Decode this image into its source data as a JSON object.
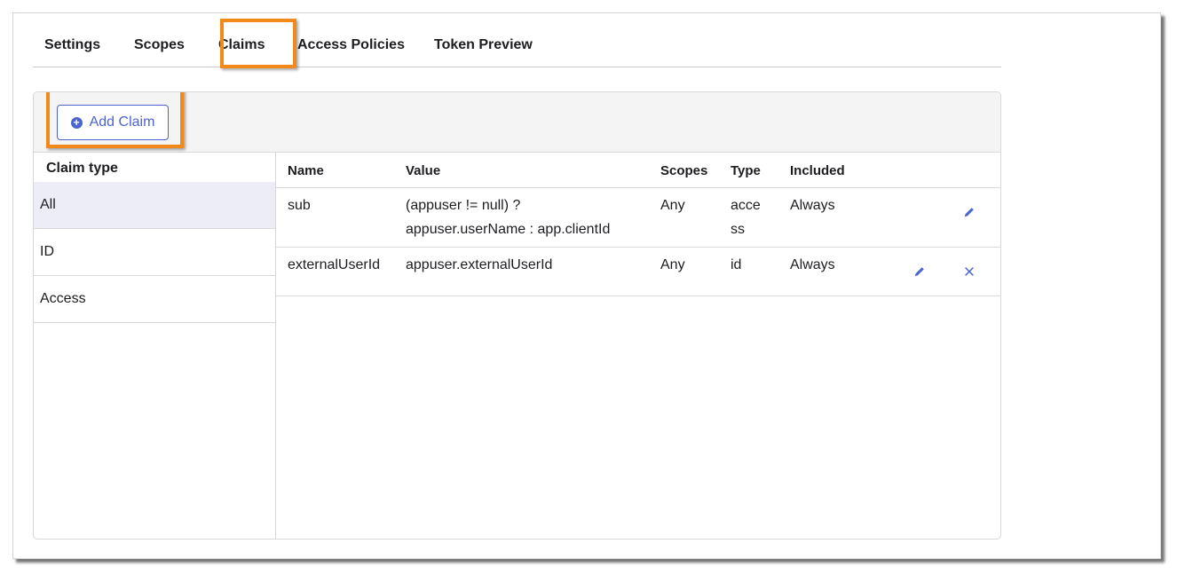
{
  "tabs": [
    {
      "label": "Settings"
    },
    {
      "label": "Scopes"
    },
    {
      "label": "Claims"
    },
    {
      "label": "Access Policies"
    },
    {
      "label": "Token Preview"
    }
  ],
  "active_tab": "Claims",
  "toolbar": {
    "add_claim_label": "Add Claim"
  },
  "sidebar": {
    "title": "Claim type",
    "items": [
      {
        "label": "All"
      },
      {
        "label": "ID"
      },
      {
        "label": "Access"
      }
    ],
    "active_item": "All"
  },
  "table": {
    "headers": {
      "name": "Name",
      "value": "Value",
      "scopes": "Scopes",
      "type": "Type",
      "included": "Included"
    },
    "rows": [
      {
        "name": "sub",
        "value_line1": "(appuser != null) ?",
        "value_line2": "appuser.userName : app.clientId",
        "scopes": "Any",
        "type_line1": "acce",
        "type_line2": "ss",
        "included": "Always"
      },
      {
        "name": "externalUserId",
        "value_line1": "appuser.externalUserId",
        "scopes": "Any",
        "type_line1": "id",
        "included": "Always"
      }
    ]
  },
  "colors": {
    "accent": "#4c63d2",
    "highlight": "#f28a1b",
    "active_bg": "#ededf8",
    "header_bg": "#f4f4f4"
  },
  "icons": [
    "plus-circle-icon",
    "pencil-icon",
    "close-icon"
  ]
}
